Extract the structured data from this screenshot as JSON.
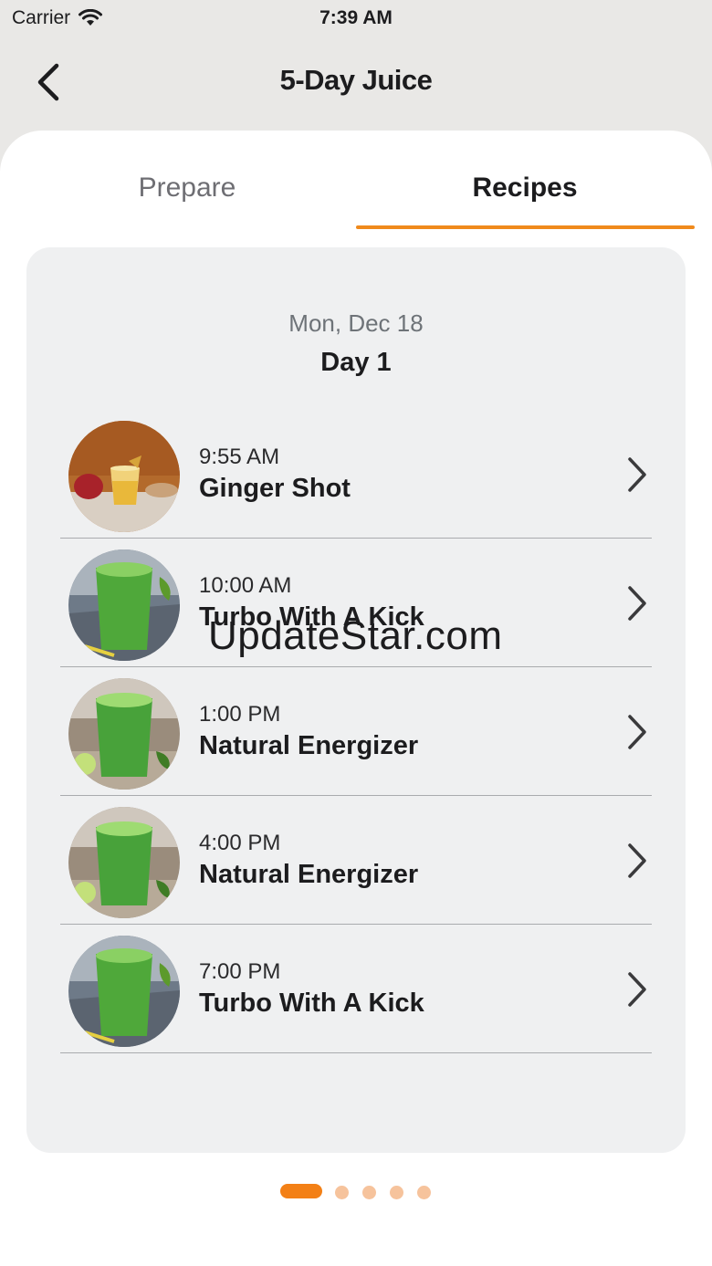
{
  "status_bar": {
    "carrier": "Carrier",
    "time": "7:39 AM"
  },
  "header": {
    "title": "5-Day Juice",
    "back_icon": "chevron-left-icon"
  },
  "tabs": [
    {
      "label": "Prepare",
      "selected": false
    },
    {
      "label": "Recipes",
      "selected": true
    }
  ],
  "accent_color": "#f08a1c",
  "day": {
    "date": "Mon, Dec 18",
    "label": "Day 1"
  },
  "recipes": [
    {
      "time": "9:55 AM",
      "name": "Ginger Shot",
      "image": "ginger-shot-photo"
    },
    {
      "time": "10:00 AM",
      "name": "Turbo With A Kick",
      "image": "green-juice-photo"
    },
    {
      "time": "1:00 PM",
      "name": "Natural Energizer",
      "image": "green-juice-photo"
    },
    {
      "time": "4:00 PM",
      "name": "Natural Energizer",
      "image": "green-juice-photo"
    },
    {
      "time": "7:00 PM",
      "name": "Turbo With A Kick",
      "image": "green-juice-photo"
    }
  ],
  "watermark": "UpdateStar.com",
  "pager": {
    "page_count": 5,
    "current_page": 1
  }
}
